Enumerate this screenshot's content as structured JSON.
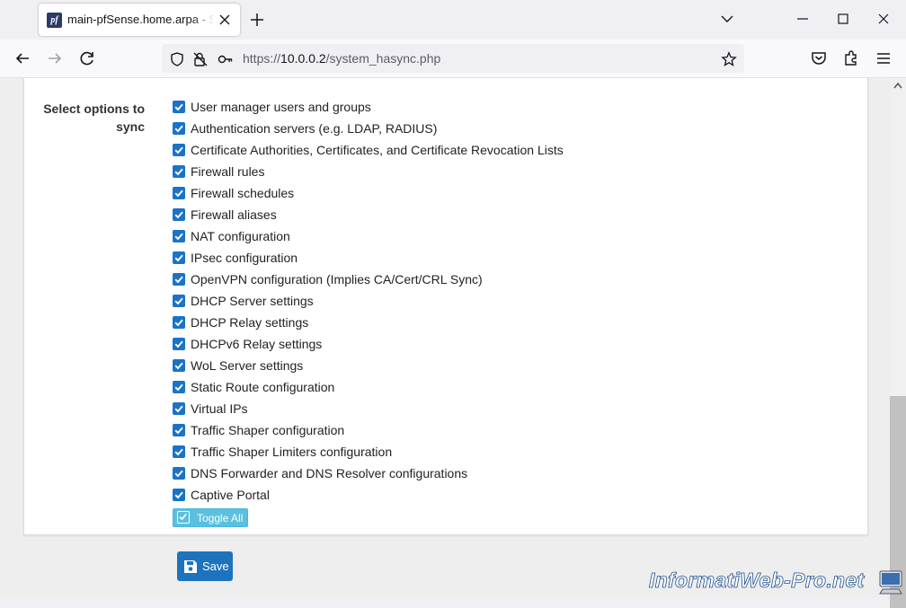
{
  "browser": {
    "tab_title": "main-pfSense.home.arpa - System / High Availability",
    "favicon_text": "pf",
    "url_host": "10.0.0.2",
    "url_prefix": "https://",
    "url_path": "/system_hasync.php"
  },
  "form": {
    "section_label": "Select options to sync",
    "options": [
      {
        "label": "User manager users and groups",
        "checked": true
      },
      {
        "label": "Authentication servers (e.g. LDAP, RADIUS)",
        "checked": true
      },
      {
        "label": "Certificate Authorities, Certificates, and Certificate Revocation Lists",
        "checked": true
      },
      {
        "label": "Firewall rules",
        "checked": true
      },
      {
        "label": "Firewall schedules",
        "checked": true
      },
      {
        "label": "Firewall aliases",
        "checked": true
      },
      {
        "label": "NAT configuration",
        "checked": true
      },
      {
        "label": "IPsec configuration",
        "checked": true
      },
      {
        "label": "OpenVPN configuration (Implies CA/Cert/CRL Sync)",
        "checked": true
      },
      {
        "label": "DHCP Server settings",
        "checked": true
      },
      {
        "label": "DHCP Relay settings",
        "checked": true
      },
      {
        "label": "DHCPv6 Relay settings",
        "checked": true
      },
      {
        "label": "WoL Server settings",
        "checked": true
      },
      {
        "label": "Static Route configuration",
        "checked": true
      },
      {
        "label": "Virtual IPs",
        "checked": true
      },
      {
        "label": "Traffic Shaper configuration",
        "checked": true
      },
      {
        "label": "Traffic Shaper Limiters configuration",
        "checked": true
      },
      {
        "label": "DNS Forwarder and DNS Resolver configurations",
        "checked": true
      },
      {
        "label": "Captive Portal",
        "checked": true
      }
    ],
    "toggle_all_label": "Toggle All",
    "save_label": "Save"
  },
  "watermark": "InformatiWeb-Pro.net",
  "colors": {
    "checkbox": "#1a73c8",
    "toggle_button": "#5bc0de",
    "save_button": "#1e73be"
  }
}
